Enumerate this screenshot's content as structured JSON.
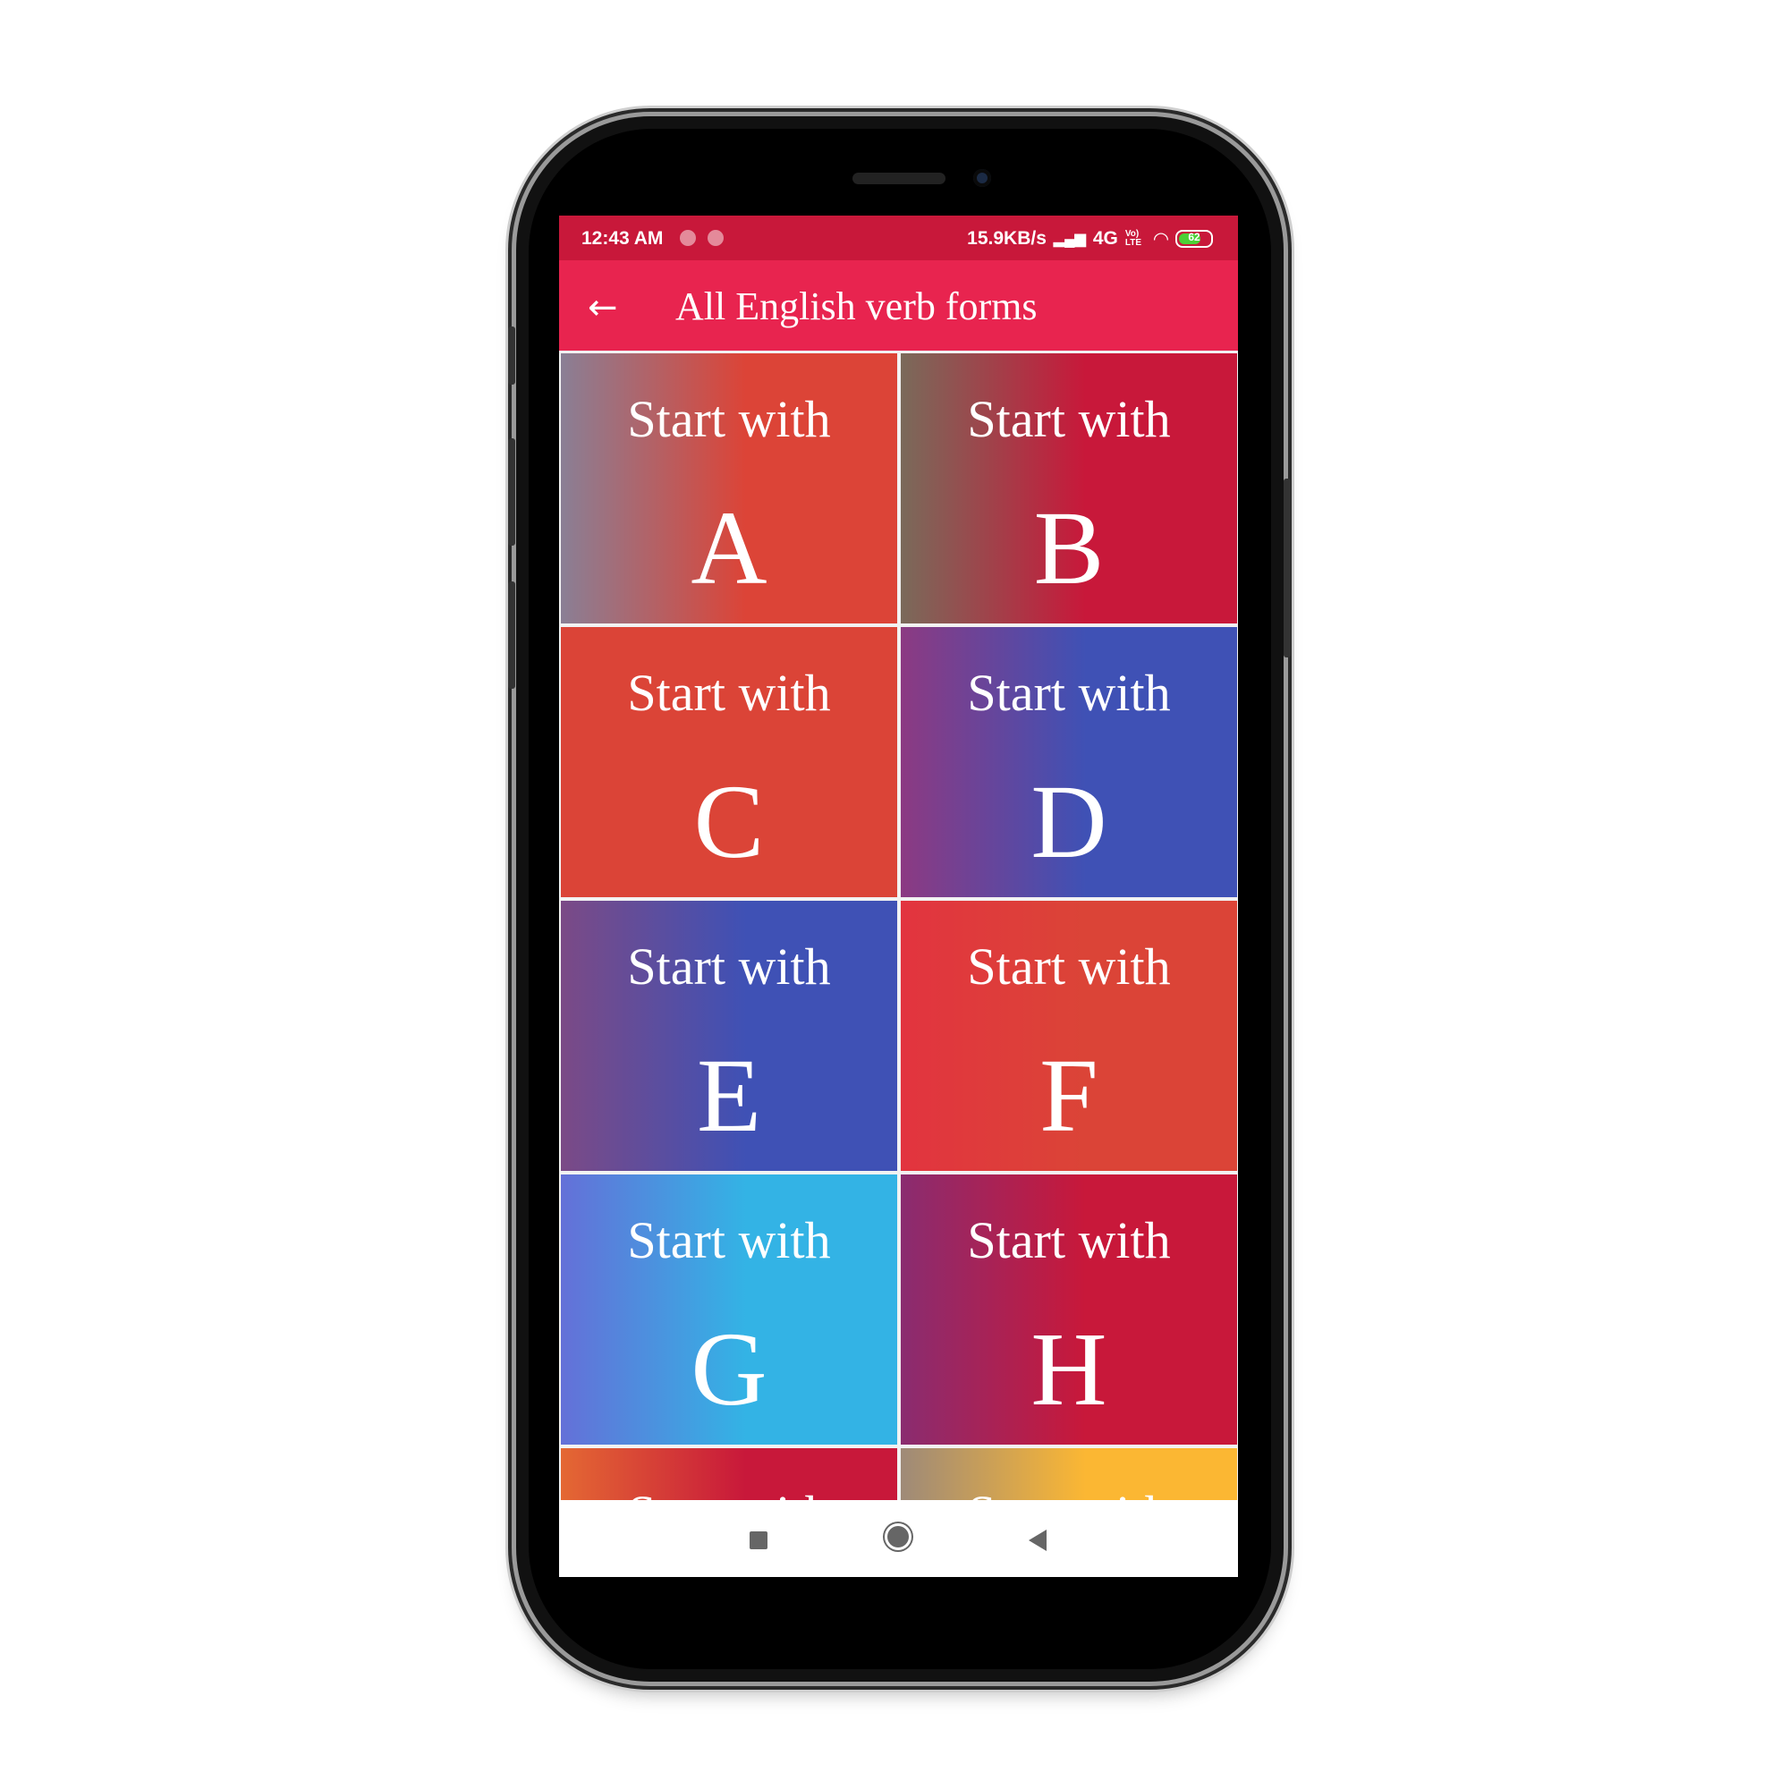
{
  "status_bar": {
    "time": "12:43 AM",
    "speed": "15.9KB/s",
    "network": "4G",
    "volte": "Vo) LTE",
    "battery": "62",
    "bg_color": "#c8183a"
  },
  "app_bar": {
    "title": "All English verb forms",
    "back_icon": "arrow-left-icon",
    "bg_color": "#e8244f"
  },
  "tiles": [
    {
      "prefix": "Start with",
      "letter": "A",
      "colors": [
        "#8a7f95",
        "#dc4437"
      ]
    },
    {
      "prefix": "Start with",
      "letter": "B",
      "colors": [
        "#7a6a5a",
        "#c8183a"
      ]
    },
    {
      "prefix": "Start with",
      "letter": "C",
      "colors": [
        "#db4437",
        "#db4437"
      ]
    },
    {
      "prefix": "Start with",
      "letter": "D",
      "colors": [
        "#8c3a82",
        "#3f51b5"
      ]
    },
    {
      "prefix": "Start with",
      "letter": "E",
      "colors": [
        "#7b4a86",
        "#3f51b5"
      ]
    },
    {
      "prefix": "Start with",
      "letter": "F",
      "colors": [
        "#e2343f",
        "#db4437"
      ]
    },
    {
      "prefix": "Start with",
      "letter": "G",
      "colors": [
        "#6470d8",
        "#33b3e5"
      ]
    },
    {
      "prefix": "Start with",
      "letter": "H",
      "colors": [
        "#8a2c70",
        "#c8183a"
      ]
    },
    {
      "prefix": "Start with",
      "letter": "",
      "colors": [
        "#e46833",
        "#c8183a"
      ]
    },
    {
      "prefix": "Start with",
      "letter": "",
      "colors": [
        "#9e8a78",
        "#fbb733"
      ]
    }
  ],
  "nav_bar": {
    "recents_icon": "square-icon",
    "home_icon": "circle-icon",
    "back_icon": "triangle-back-icon"
  }
}
